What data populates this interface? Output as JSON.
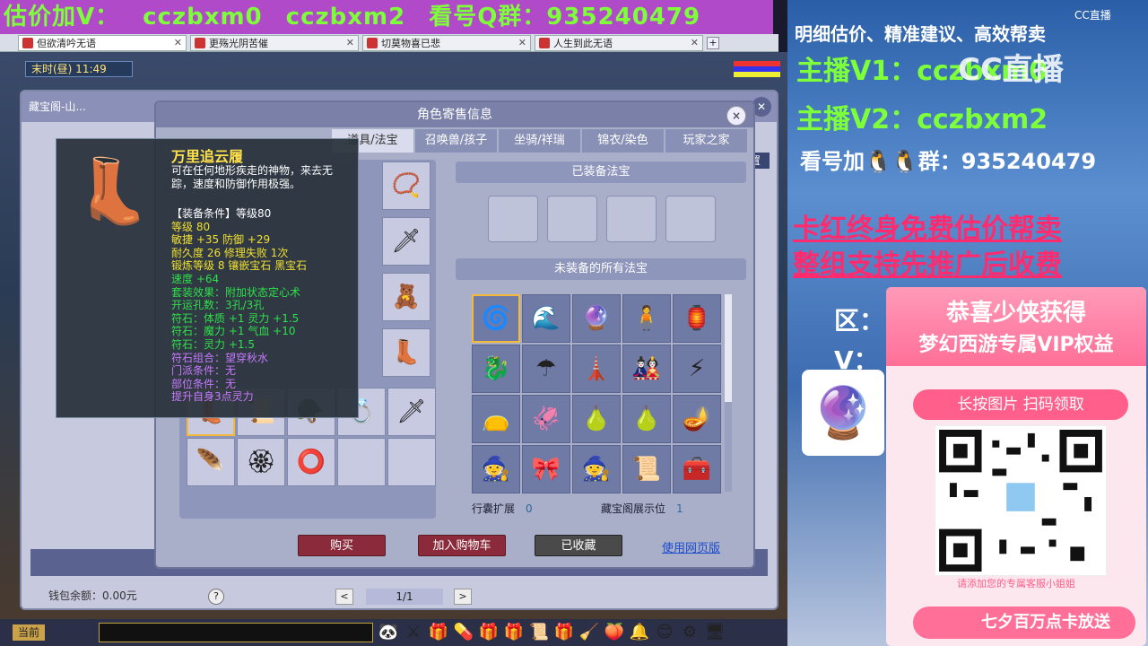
{
  "banner": {
    "part1": "估价加V：",
    "part2": "cczbxm0",
    "part3": "cczbxm2",
    "part4": "看号Q群：935240479"
  },
  "browser_tabs": [
    {
      "label": "但欲清吟无语"
    },
    {
      "label": "更殇光阴苦催"
    },
    {
      "label": "切莫物喜已悲"
    },
    {
      "label": "人生到此无语"
    }
  ],
  "game": {
    "time_text": "末时(昼) 11:49",
    "underlying_window": {
      "title": "藏宝阁-山...",
      "settings_label": "设置",
      "wallet_text": "钱包余额：0.00元",
      "help_label": "?",
      "pager": {
        "prev": "<",
        "text": "1/1",
        "next": ">"
      }
    },
    "dialog": {
      "title": "角色寄售信息",
      "close": "×",
      "tabs": [
        {
          "label": "道具/法宝",
          "active": true
        },
        {
          "label": "召唤兽/孩子",
          "active": false
        },
        {
          "label": "坐骑/祥瑞",
          "active": false
        },
        {
          "label": "锦衣/染色",
          "active": false
        },
        {
          "label": "玩家之家",
          "active": false
        }
      ],
      "equipped_header": "已装备法宝",
      "unequipped_header": "未装备的所有法宝",
      "bag_expansion_label": "行囊扩展",
      "bag_expansion_value": "0",
      "treasure_display_label": "藏宝阁展示位",
      "treasure_display_value": "1",
      "buy_label": "购买",
      "cart_label": "加入购物车",
      "fav_label": "已收藏",
      "web_link": "使用网页版"
    },
    "tooltip": {
      "name": "万里追云履",
      "desc": "可在任何地形疾走的神物，来去无踪，速度和防御作用极强。",
      "lines": [
        {
          "text": "【装备条件】等级80",
          "color": "white"
        },
        {
          "text": "等级 80",
          "color": "yellow"
        },
        {
          "text": "敏捷 +35 防御 +29",
          "color": "yellow"
        },
        {
          "text": "耐久度 26  修理失败 1次",
          "color": "yellow"
        },
        {
          "text": "锻炼等级 8  镶嵌宝石 黑宝石",
          "color": "yellow"
        },
        {
          "text": "速度 +64",
          "color": "green"
        },
        {
          "text": "套装效果：附加状态定心术",
          "color": "green"
        },
        {
          "text": "开运孔数：3孔/3孔",
          "color": "green"
        },
        {
          "text": "符石：体质 +1 灵力 +1.5",
          "color": "green"
        },
        {
          "text": "符石：魔力 +1 气血 +10",
          "color": "green"
        },
        {
          "text": "符石：灵力 +1.5",
          "color": "green"
        },
        {
          "text": "符石组合：望穿秋水",
          "color": "lpurple"
        },
        {
          "text": "门派条件：无",
          "color": "lpurple"
        },
        {
          "text": "部位条件：无",
          "color": "lpurple"
        },
        {
          "text": "提升自身3点灵力",
          "color": "lpurple"
        }
      ]
    },
    "bottom": {
      "current_label": "当前"
    }
  },
  "stream": {
    "line1": "明细估价、精准建议、高效帮卖",
    "line2": "主播V1：cczbxm0",
    "line3": "主播V2：cczbxm2",
    "line4": "看号加🐧🐧群：935240479",
    "line5": "卡红终身免费估价帮卖",
    "line6": "整组支持先推广后收费",
    "cc_logo": "CC直播",
    "watermark": "CC直播",
    "zone_label": "区：",
    "v_label": "V：",
    "vip_card": {
      "title1": "恭喜少侠获得",
      "title2": "梦幻西游专属VIP权益",
      "qr_header": "长按图片  扫码领取",
      "note": "请添加您的专属客服小姐姐",
      "promo": "七夕百万点卡放送"
    }
  },
  "colors": {
    "banner_bg": "#b04ac8",
    "banner_text": "#7dff3a",
    "buy_button": "#8a2a3a",
    "stream_green": "#7dff3a",
    "stream_pink": "#ff2b6e"
  }
}
